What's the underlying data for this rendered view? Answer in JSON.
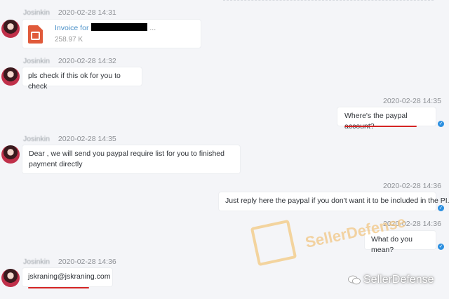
{
  "messages": [
    {
      "side": "left",
      "name": "Josinkin",
      "time": "2020-02-28 14:31",
      "type": "file",
      "file_title": "Invoice for",
      "file_size": "258.97 K"
    },
    {
      "side": "left",
      "name": "Josinkin",
      "time": "2020-02-28 14:32",
      "text": "pls check if this ok for you to check"
    },
    {
      "side": "right",
      "time": "2020-02-28 14:35",
      "text": "Where's the paypal account?"
    },
    {
      "side": "left",
      "name": "Josinkin",
      "time": "2020-02-28 14:35",
      "text_line1": "Dear , we will send you paypal require list for you to finished",
      "text_line2": "payment directly"
    },
    {
      "side": "right",
      "time": "2020-02-28 14:36",
      "text": "Just reply here the paypal if you don't want it to be included in the PI."
    },
    {
      "side": "right",
      "time": "2020-02-28 14:36",
      "text": "What do you mean?"
    },
    {
      "side": "left",
      "name": "Josinkin",
      "time": "2020-02-28 14:36",
      "text": "jskraning@jskraning.com"
    }
  ],
  "watermark": {
    "text": "SellerDefense"
  },
  "brand": {
    "text": "SellerDefense"
  },
  "colors": {
    "background": "#f4f5f8",
    "accent": "#2b8fe0",
    "underline": "#d42424",
    "watermark": "#f2c785"
  }
}
